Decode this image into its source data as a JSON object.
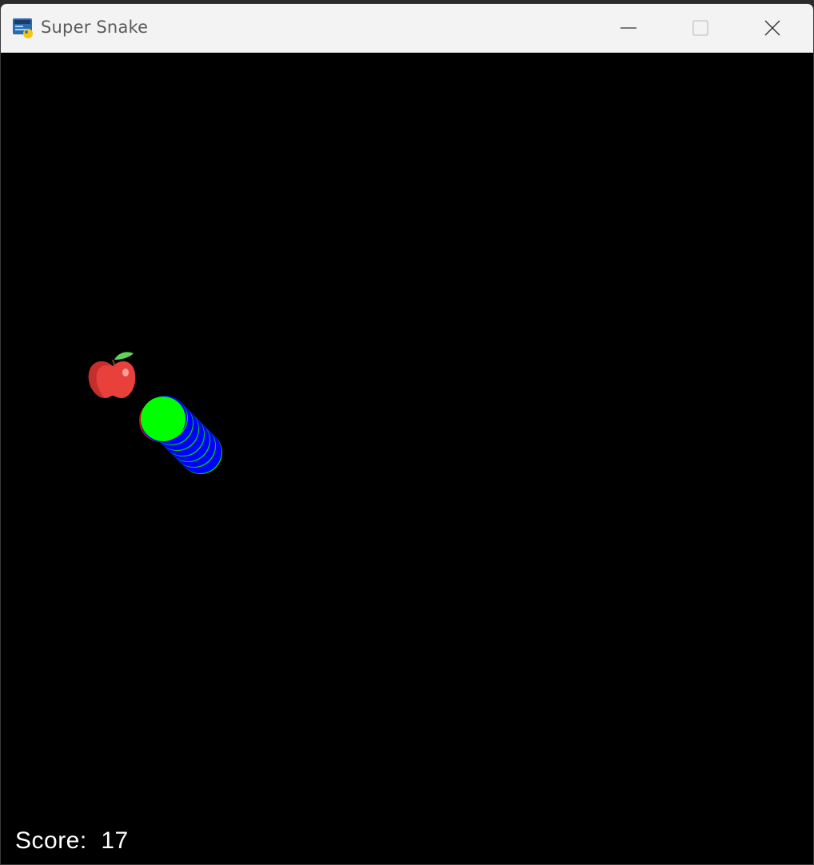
{
  "window": {
    "title": "Super Snake",
    "icon": "python-pygame-icon",
    "controls": {
      "minimize": "minimize-icon",
      "maximize": "maximize-icon",
      "close": "close-icon"
    }
  },
  "game": {
    "score_label": "Score:",
    "score_value": "17",
    "score_text": "Score:  17",
    "background_color": "#000000",
    "apple_color": "#e8413c",
    "snake_head_color": "#00ff00",
    "snake_body_color": "#0000ff"
  }
}
